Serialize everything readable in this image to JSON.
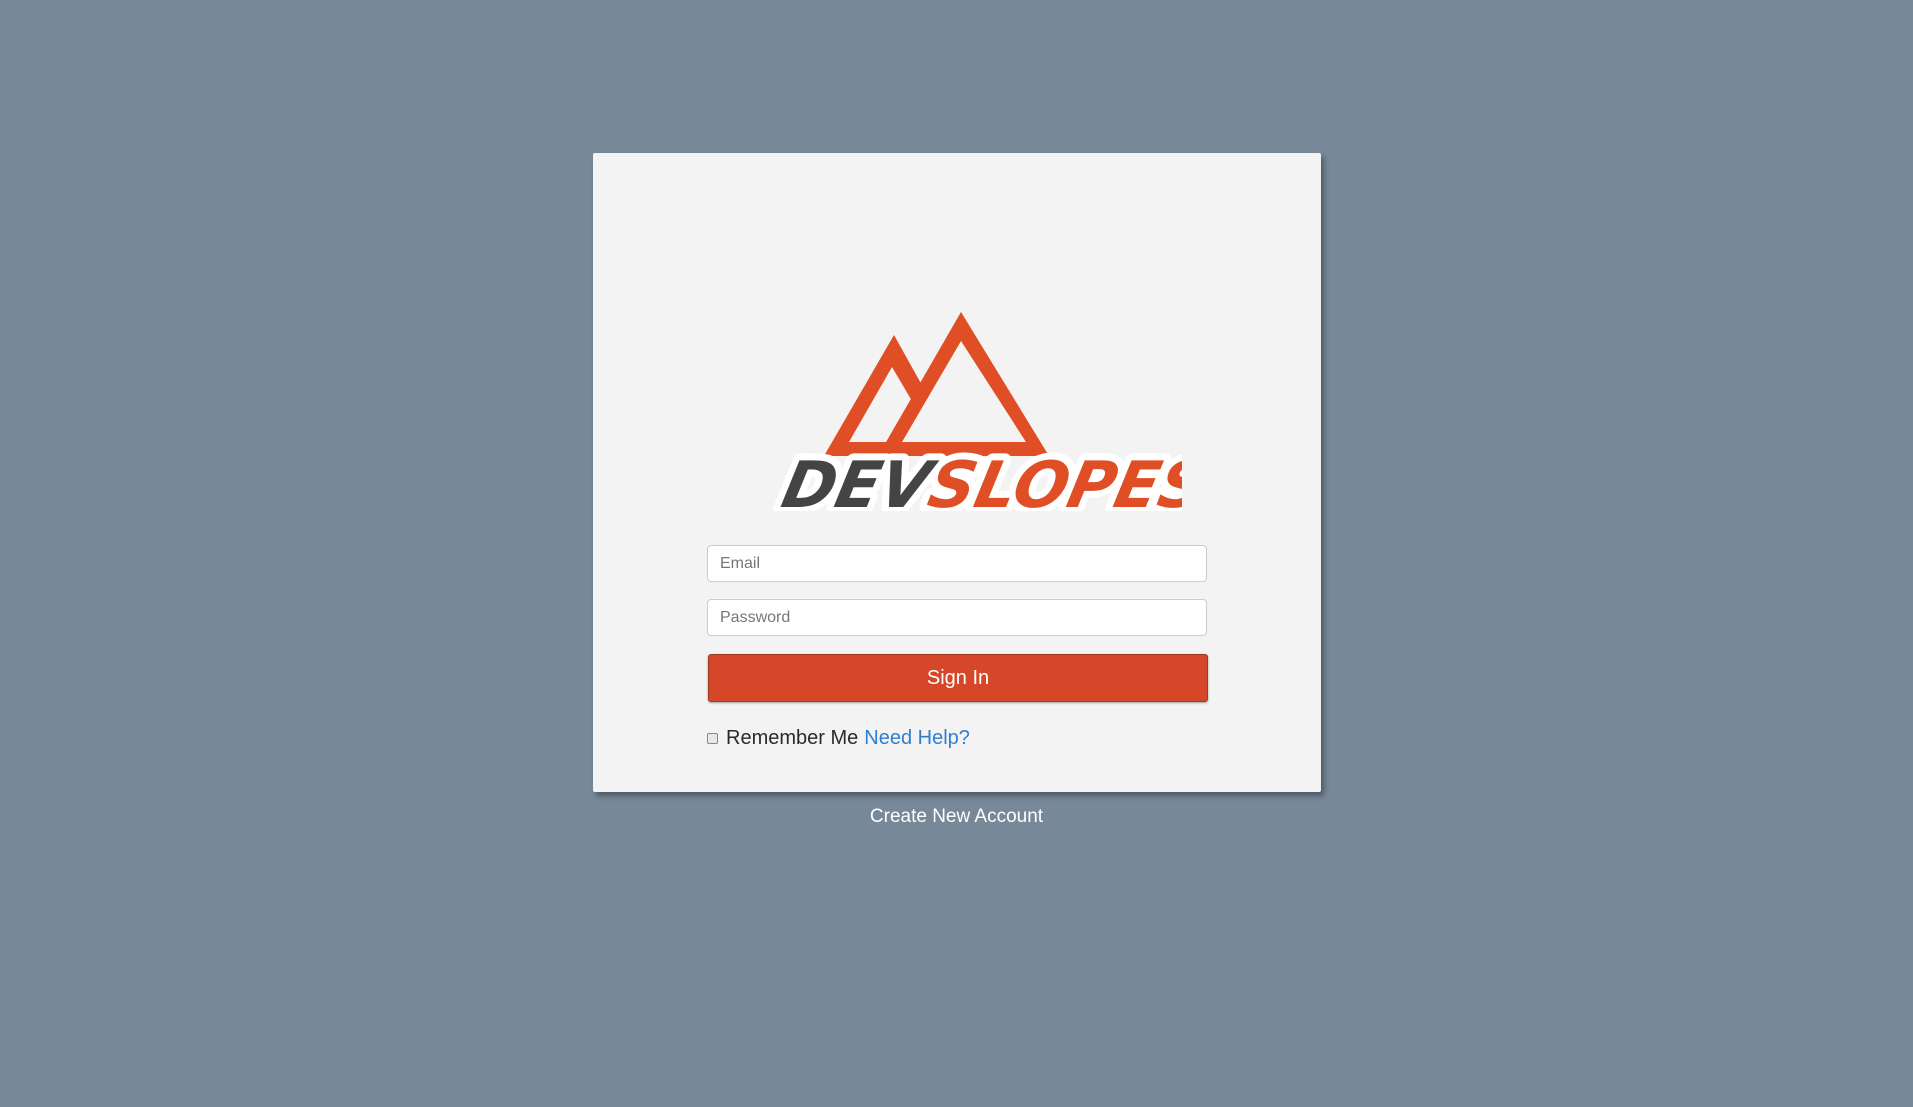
{
  "brand": {
    "logo_icon": "mountain-icon",
    "logo_text_dark": "DEV",
    "logo_text_accent": "SLOPES",
    "accent_color": "#d64729"
  },
  "form": {
    "email_placeholder": "Email",
    "password_placeholder": "Password",
    "email_value": "",
    "password_value": "",
    "signin_label": "Sign In",
    "remember_label": "Remember Me",
    "remember_checked": false,
    "help_link": "Need Help?"
  },
  "footer": {
    "create_account": "Create New Account"
  },
  "colors": {
    "background": "#778899",
    "card": "#f3f3f3",
    "link": "#2f7fd0"
  }
}
